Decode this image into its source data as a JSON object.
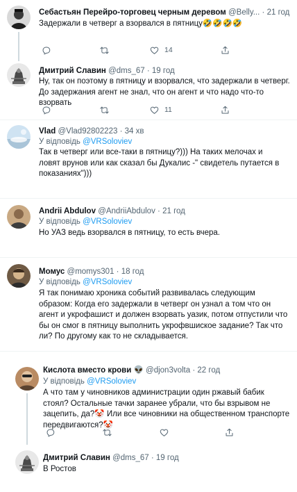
{
  "replying_to_label": "У відповідь",
  "mention": "@VRSoloviev",
  "tweets": [
    {
      "name": "Себастьян Перейро-торговец черным деревом",
      "handle": "@Belly...",
      "time": "21 год",
      "text": "Задержали в четверг а взорвался в пятницу🤣🤣🤣🤣",
      "replies": "",
      "retweets": "",
      "likes": "14"
    },
    {
      "name": "Дмитрий Славин",
      "handle": "@dms_67",
      "time": "19 год",
      "text": "Ну, так он поэтому в пятницу и взорвался, что задержали в четверг. До задержания агент не знал, что он агент и что надо что-то взорвать",
      "replies": "",
      "retweets": "",
      "likes": "11"
    },
    {
      "name": "Vlad",
      "handle": "@Vlad92802223",
      "time": "34 хв",
      "text": "Так в четверг или все-таки в пятницу?))) На таких мелочах и ловят врунов или как сказал бы Дукалис -\" свидетель путается в показаниях\")))"
    },
    {
      "name": "Andrii Abdulov",
      "handle": "@AndriiAbdulov",
      "time": "21 год",
      "text": "Но УАЗ ведь взорвался в пятницу, то есть вчера."
    },
    {
      "name": "Момус",
      "handle": "@momys301",
      "time": "18 год",
      "text": "Я так понимаю хроника событий развивалась следующим образом: Когда его задержали в четверг он узнал а том что он агент и укрофашист и должен взорвать уазик, потом отпустили что бы он смог в пятницу выполнить укрофвшиское задание? Так что ли? По другому как то не складывается."
    },
    {
      "name": "Кислота вместо крови 👽",
      "handle": "@djon3volta",
      "time": "22 год",
      "text": "А что там у чиновников администрации один ржавый бабик стоял? Остальные тачки заранее убрали, что бы взрывом не зацепить, да?🤡 Или все чиновники на общественном транспорте передвигаются?🤡"
    },
    {
      "name": "Дмитрий Славин",
      "handle": "@dms_67",
      "time": "19 год",
      "text": "В Ростов"
    }
  ],
  "icons": {
    "reply": "reply-icon",
    "retweet": "retweet-icon",
    "like": "heart-icon",
    "share": "share-icon"
  },
  "colors": {
    "link": "#1d9bf0",
    "muted": "#536471",
    "connector": "#cfd9de"
  }
}
